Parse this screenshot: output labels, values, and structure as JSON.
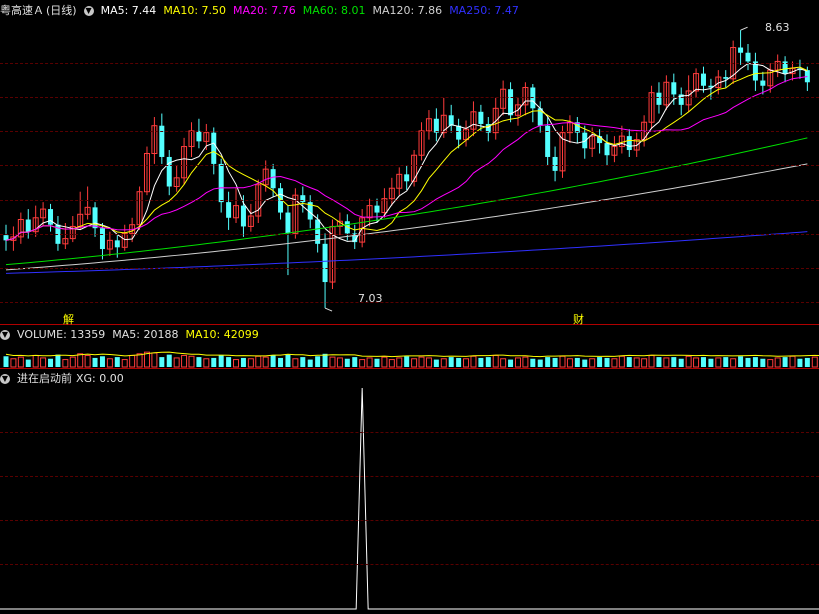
{
  "header": {
    "stock_name": "粤高速Ａ",
    "period": "(日线)",
    "ma5_label": "MA5: 7.44",
    "ma10_label": "MA10: 7.50",
    "ma20_label": "MA20: 7.76",
    "ma60_label": "MA60: 8.01",
    "ma120_label": "MA120: 7.86",
    "ma250_label": "MA250: 7.47"
  },
  "volume_header": {
    "volume_label": "VOLUME: 13359",
    "ma5_label": "MA5: 20188",
    "ma10_label": "MA10: 42099"
  },
  "indicator_header": {
    "name": "进在启动前",
    "xg_label": "XG: 0.00"
  },
  "markers": {
    "high_label": "8.63",
    "low_label": "7.03",
    "event_jie": "解",
    "event_cai": "财"
  },
  "colors": {
    "up": "#ff3c3c",
    "down": "#54ffff",
    "ma5": "#ffffff",
    "ma10": "#ffff00",
    "ma20": "#ff00ff",
    "ma60": "#00e000",
    "ma120": "#d0d0d0",
    "ma250": "#3030ff"
  },
  "chart_data": {
    "type": "candlestick",
    "ylim": [
      6.95,
      8.7
    ],
    "high_point": 8.63,
    "low_point": 7.03,
    "candles": [
      [
        7.45,
        7.42,
        7.51,
        7.36
      ],
      [
        7.42,
        7.44,
        7.5,
        7.36
      ],
      [
        7.44,
        7.54,
        7.58,
        7.4
      ],
      [
        7.54,
        7.47,
        7.6,
        7.43
      ],
      [
        7.47,
        7.55,
        7.62,
        7.44
      ],
      [
        7.55,
        7.6,
        7.64,
        7.5
      ],
      [
        7.6,
        7.51,
        7.63,
        7.47
      ],
      [
        7.51,
        7.4,
        7.56,
        7.36
      ],
      [
        7.4,
        7.43,
        7.52,
        7.37
      ],
      [
        7.43,
        7.5,
        7.56,
        7.41
      ],
      [
        7.5,
        7.57,
        7.7,
        7.48
      ],
      [
        7.57,
        7.61,
        7.73,
        7.54
      ],
      [
        7.61,
        7.49,
        7.64,
        7.44
      ],
      [
        7.49,
        7.37,
        7.52,
        7.31
      ],
      [
        7.37,
        7.42,
        7.47,
        7.33
      ],
      [
        7.42,
        7.38,
        7.45,
        7.32
      ],
      [
        7.38,
        7.46,
        7.51,
        7.36
      ],
      [
        7.46,
        7.51,
        7.55,
        7.41
      ],
      [
        7.51,
        7.7,
        7.73,
        7.48
      ],
      [
        7.7,
        7.92,
        7.96,
        7.68
      ],
      [
        7.92,
        8.08,
        8.13,
        7.86
      ],
      [
        8.08,
        7.9,
        8.15,
        7.86
      ],
      [
        7.9,
        7.73,
        7.94,
        7.68
      ],
      [
        7.73,
        7.78,
        7.85,
        7.7
      ],
      [
        7.78,
        7.96,
        8.01,
        7.74
      ],
      [
        7.96,
        8.05,
        8.1,
        7.9
      ],
      [
        8.05,
        7.99,
        8.12,
        7.95
      ],
      [
        7.99,
        8.04,
        8.09,
        7.94
      ],
      [
        8.04,
        7.86,
        8.07,
        7.8
      ],
      [
        7.86,
        7.64,
        7.89,
        7.58
      ],
      [
        7.64,
        7.55,
        7.7,
        7.48
      ],
      [
        7.55,
        7.62,
        7.72,
        7.52
      ],
      [
        7.62,
        7.5,
        7.68,
        7.44
      ],
      [
        7.5,
        7.56,
        7.63,
        7.47
      ],
      [
        7.56,
        7.74,
        7.77,
        7.52
      ],
      [
        7.74,
        7.83,
        7.88,
        7.7
      ],
      [
        7.83,
        7.72,
        7.86,
        7.67
      ],
      [
        7.72,
        7.58,
        7.75,
        7.54
      ],
      [
        7.58,
        7.46,
        7.62,
        7.22
      ],
      [
        7.46,
        7.68,
        7.72,
        7.43
      ],
      [
        7.68,
        7.64,
        7.73,
        7.58
      ],
      [
        7.64,
        7.54,
        7.68,
        7.49
      ],
      [
        7.54,
        7.4,
        7.57,
        7.35
      ],
      [
        7.4,
        7.18,
        7.46,
        7.03
      ],
      [
        7.18,
        7.5,
        7.54,
        7.14
      ],
      [
        7.5,
        7.53,
        7.58,
        7.45
      ],
      [
        7.53,
        7.46,
        7.57,
        7.42
      ],
      [
        7.46,
        7.41,
        7.51,
        7.37
      ],
      [
        7.41,
        7.55,
        7.6,
        7.38
      ],
      [
        7.55,
        7.62,
        7.66,
        7.5
      ],
      [
        7.62,
        7.58,
        7.66,
        7.52
      ],
      [
        7.58,
        7.66,
        7.72,
        7.55
      ],
      [
        7.66,
        7.72,
        7.78,
        7.62
      ],
      [
        7.72,
        7.8,
        7.84,
        7.68
      ],
      [
        7.8,
        7.76,
        7.85,
        7.71
      ],
      [
        7.76,
        7.91,
        7.94,
        7.73
      ],
      [
        7.91,
        8.05,
        8.1,
        7.88
      ],
      [
        8.05,
        8.12,
        8.17,
        8.0
      ],
      [
        8.12,
        8.04,
        8.18,
        7.99
      ],
      [
        8.04,
        8.14,
        8.24,
        8.01
      ],
      [
        8.14,
        8.08,
        8.2,
        8.04
      ],
      [
        8.08,
        8.0,
        8.12,
        7.95
      ],
      [
        8.0,
        8.06,
        8.11,
        7.96
      ],
      [
        8.06,
        8.16,
        8.22,
        8.02
      ],
      [
        8.16,
        8.09,
        8.2,
        8.05
      ],
      [
        8.09,
        8.04,
        8.13,
        7.99
      ],
      [
        8.04,
        8.18,
        8.24,
        8.0
      ],
      [
        8.18,
        8.29,
        8.34,
        8.14
      ],
      [
        8.29,
        8.14,
        8.33,
        8.1
      ],
      [
        8.14,
        8.2,
        8.24,
        8.08
      ],
      [
        8.2,
        8.3,
        8.33,
        8.14
      ],
      [
        8.3,
        8.18,
        8.32,
        8.1
      ],
      [
        8.18,
        8.08,
        8.22,
        8.04
      ],
      [
        8.08,
        7.9,
        8.13,
        7.85
      ],
      [
        7.9,
        7.82,
        7.96,
        7.76
      ],
      [
        7.82,
        8.04,
        8.08,
        7.78
      ],
      [
        8.04,
        8.1,
        8.14,
        7.98
      ],
      [
        8.1,
        8.04,
        8.13,
        7.98
      ],
      [
        8.04,
        7.95,
        8.08,
        7.89
      ],
      [
        7.95,
        8.02,
        8.07,
        7.9
      ],
      [
        8.02,
        7.98,
        8.06,
        7.92
      ],
      [
        7.98,
        7.91,
        8.03,
        7.85
      ],
      [
        7.91,
        7.96,
        8.02,
        7.87
      ],
      [
        7.96,
        8.02,
        8.08,
        7.92
      ],
      [
        8.02,
        7.94,
        8.06,
        7.9
      ],
      [
        7.94,
        8.0,
        8.04,
        7.9
      ],
      [
        8.0,
        8.1,
        8.14,
        7.96
      ],
      [
        8.1,
        8.27,
        8.31,
        8.06
      ],
      [
        8.27,
        8.2,
        8.33,
        8.15
      ],
      [
        8.2,
        8.33,
        8.37,
        8.17
      ],
      [
        8.33,
        8.26,
        8.38,
        8.2
      ],
      [
        8.26,
        8.2,
        8.3,
        8.14
      ],
      [
        8.2,
        8.28,
        8.37,
        8.16
      ],
      [
        8.28,
        8.38,
        8.41,
        8.24
      ],
      [
        8.38,
        8.31,
        8.42,
        8.27
      ],
      [
        8.31,
        8.3,
        8.35,
        8.23
      ],
      [
        8.3,
        8.36,
        8.4,
        8.26
      ],
      [
        8.36,
        8.35,
        8.4,
        8.3
      ],
      [
        8.35,
        8.53,
        8.57,
        8.32
      ],
      [
        8.53,
        8.5,
        8.63,
        8.43
      ],
      [
        8.5,
        8.45,
        8.55,
        8.4
      ],
      [
        8.45,
        8.34,
        8.5,
        8.28
      ],
      [
        8.34,
        8.31,
        8.39,
        8.26
      ],
      [
        8.31,
        8.4,
        8.44,
        8.27
      ],
      [
        8.4,
        8.45,
        8.49,
        8.36
      ],
      [
        8.45,
        8.38,
        8.48,
        8.33
      ],
      [
        8.38,
        8.41,
        8.45,
        8.34
      ],
      [
        8.41,
        8.4,
        8.46,
        8.35
      ],
      [
        8.4,
        8.33,
        8.42,
        8.28
      ]
    ],
    "ma60_endpoints": [
      7.28,
      8.01
    ],
    "ma120_endpoints": [
      7.25,
      7.86
    ],
    "ma250_endpoints": [
      7.23,
      7.47
    ],
    "volume": [
      13,
      10,
      12,
      9,
      14,
      11,
      10,
      15,
      9,
      12,
      16,
      14,
      11,
      13,
      10,
      12,
      9,
      14,
      16,
      18,
      17,
      12,
      15,
      11,
      14,
      13,
      12,
      10,
      11,
      14,
      12,
      9,
      11,
      10,
      13,
      12,
      14,
      11,
      15,
      10,
      12,
      9,
      13,
      16,
      12,
      11,
      10,
      12,
      9,
      11,
      10,
      12,
      9,
      11,
      13,
      10,
      12,
      11,
      9,
      10,
      12,
      11,
      10,
      13,
      11,
      12,
      14,
      10,
      9,
      11,
      12,
      10,
      9,
      12,
      11,
      13,
      10,
      11,
      9,
      10,
      12,
      11,
      10,
      13,
      12,
      11,
      10,
      14,
      12,
      11,
      12,
      10,
      13,
      11,
      12,
      10,
      11,
      12,
      10,
      13,
      11,
      12,
      10,
      9,
      11,
      12,
      13,
      10,
      11,
      12,
      11
    ],
    "xg_signal_index": 48,
    "xg_value": 0.0
  }
}
